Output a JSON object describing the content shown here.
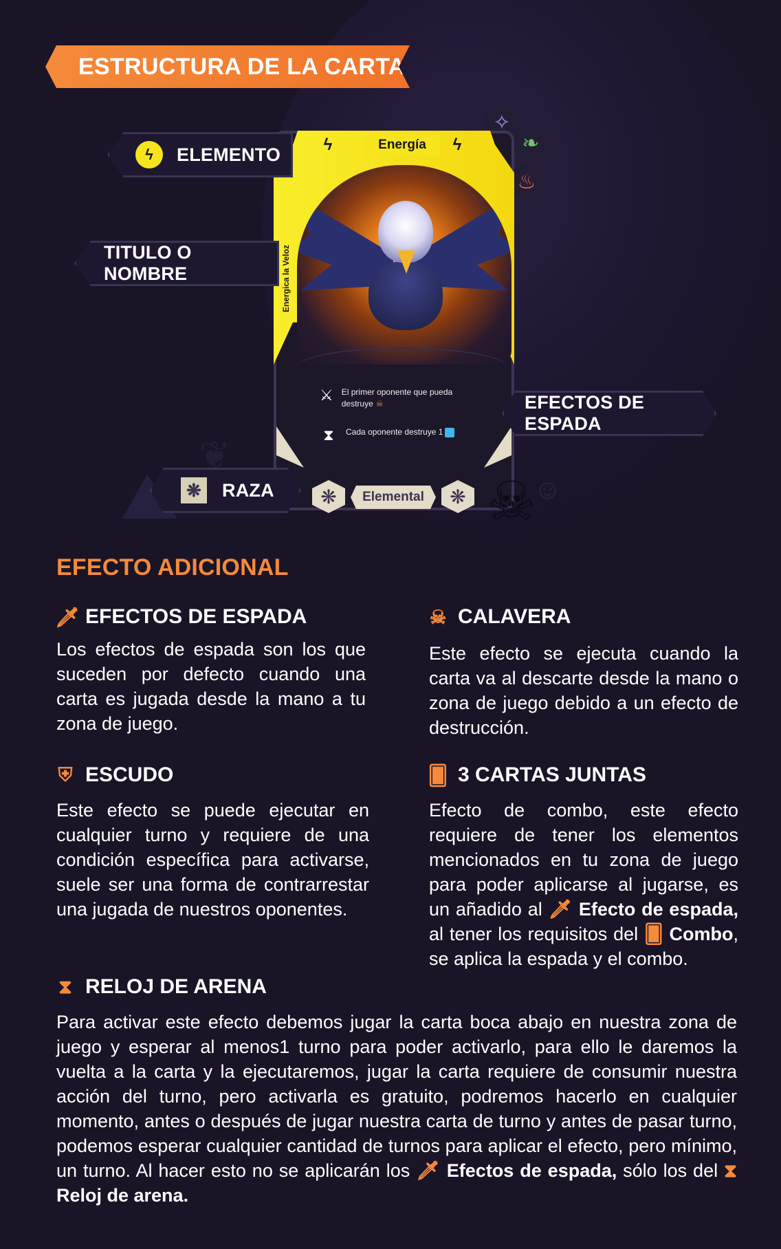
{
  "header": {
    "title": "ESTRUCTURA DE LA CARTA"
  },
  "labels": {
    "elemento": "ELEMENTO",
    "titulo": "TITULO O NOMBRE",
    "efectos_espada": "EFECTOS DE ESPADA",
    "raza": "RAZA"
  },
  "card": {
    "element_name": "Energía",
    "title": "Energica la Veloz",
    "effect_sword": "El primer oponente que pueda destruye",
    "effect_hourglass": "Cada oponente destruye 1",
    "race": "Elemental"
  },
  "icons": [
    "lightning-icon",
    "star-icon",
    "leaf-icon",
    "fire-icon",
    "sword-icon",
    "hourglass-icon",
    "skull-icon",
    "shield-icon",
    "cards-icon",
    "race-icon"
  ],
  "colors": {
    "accent": "#f48a3a",
    "background": "#1a1427",
    "energy": "#f6e51d"
  },
  "section": {
    "heading": "EFECTO ADICIONAL",
    "espada": {
      "title": "EFECTOS DE ESPADA",
      "text": "Los efectos de espada son los que suceden por defecto cuando una carta es jugada desde la mano a tu zona de juego."
    },
    "calavera": {
      "title": "CALAVERA",
      "text": "Este efecto se ejecuta cuando la carta va al descarte desde la mano o zona de juego debido a un efecto de destrucción."
    },
    "escudo": {
      "title": "ESCUDO",
      "text": "Este efecto se puede ejecutar en cualquier turno y requiere de una condición específica para activarse, suele ser una forma de contrarrestar una jugada de nuestros oponentes."
    },
    "cartas": {
      "title": "3 CARTAS JUNTAS",
      "text_a": "Efecto de combo, este efecto requiere de tener los elementos mencionados en tu zona de juego para poder aplicarse al jugarse, es un añadido al ",
      "bold_a": "Efecto de espada,",
      "text_b": " al tener los requisitos del ",
      "bold_b": "Combo",
      "text_c": ", se aplica la espada y el combo."
    },
    "reloj": {
      "title": "RELOJ DE ARENA",
      "text_a": "Para activar este efecto debemos jugar la carta boca abajo en nuestra zona de juego y esperar al menos1 turno para poder activarlo, para ello le daremos la vuelta a la carta y la ejecutaremos, jugar la carta requiere de consumir nuestra acción del turno, pero activarla es gratuito, podremos hacerlo en cualquier momento, antes o después de jugar nuestra carta de turno y antes de pasar turno, podemos esperar cualquier cantidad de turnos para aplicar el efecto, pero mínimo, un turno. Al hacer esto no se aplicarán los ",
      "bold_a": "Efectos de espada,",
      "text_b": " sólo los del ",
      "bold_b": "Reloj de arena."
    }
  }
}
